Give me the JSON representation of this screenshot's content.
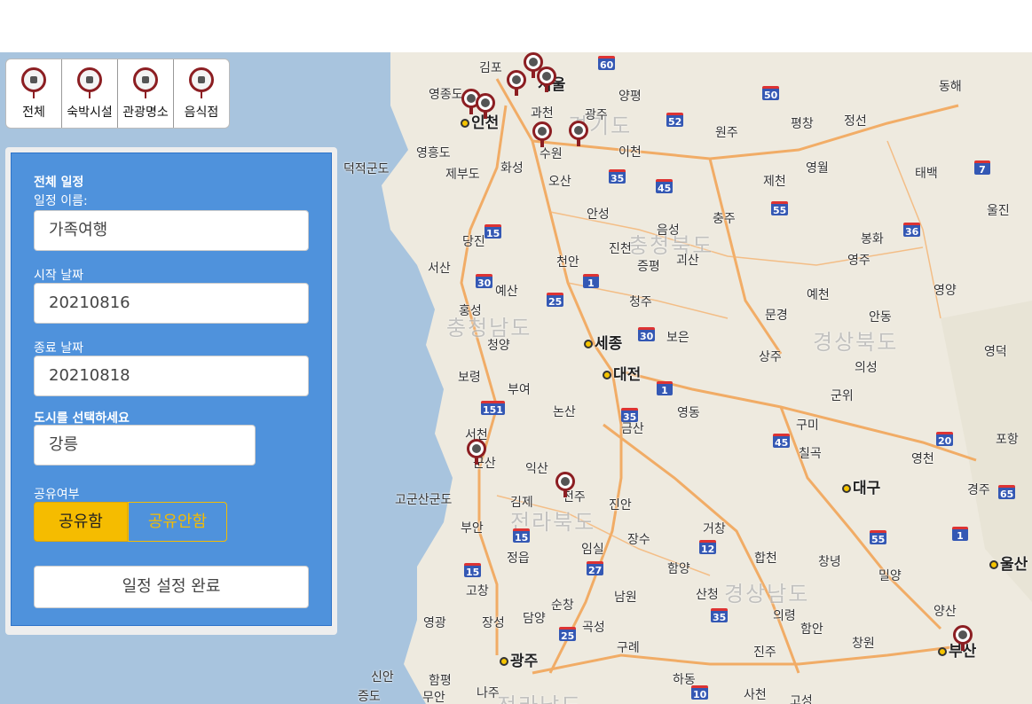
{
  "toolbar": {
    "items": [
      {
        "label": "전체",
        "icon": "airplane-pin-icon"
      },
      {
        "label": "숙박시설",
        "icon": "bed-pin-icon"
      },
      {
        "label": "관광명소",
        "icon": "camera-pin-icon"
      },
      {
        "label": "음식점",
        "icon": "restaurant-pin-icon"
      }
    ]
  },
  "panel": {
    "title": "전체 일정",
    "name_label": "일정 이름:",
    "name_value": "가족여행",
    "start_label": "시작 날짜",
    "start_value": "20210816",
    "end_label": "종료 날짜",
    "end_value": "20210818",
    "city_label": "도시를 선택하세요",
    "city_value": "강릉",
    "share_label": "공유여부",
    "share_on": "공유함",
    "share_off": "공유안함",
    "submit": "일정 설정 완료"
  },
  "map": {
    "cities": [
      "김포",
      "서울",
      "영종도",
      "인천",
      "과천",
      "광주",
      "양평",
      "수원",
      "이천",
      "원주",
      "평창",
      "정선",
      "동해",
      "영흥도",
      "덕적군도",
      "제부도",
      "화성",
      "오산",
      "영월",
      "태백",
      "울진",
      "안성",
      "음성",
      "충주",
      "제천",
      "당진",
      "진천",
      "증평",
      "괴산",
      "봉화",
      "영주",
      "서산",
      "천안",
      "예산",
      "청주",
      "예천",
      "영양",
      "홍성",
      "문경",
      "안동",
      "청양",
      "세종",
      "보은",
      "상주",
      "영덕",
      "보령",
      "대전",
      "의성",
      "부여",
      "영동",
      "군위",
      "논산",
      "금산",
      "구미",
      "포항",
      "서천",
      "군산",
      "칠곡",
      "영천",
      "고군산군도",
      "익산",
      "김제",
      "전주",
      "진안",
      "대구",
      "경주",
      "울산",
      "부안",
      "정읍",
      "임실",
      "장수",
      "거창",
      "합천",
      "창녕",
      "밀양",
      "고창",
      "함양",
      "산청",
      "남원",
      "양산",
      "영광",
      "장성",
      "담양",
      "순창",
      "의령",
      "함안",
      "창원",
      "부산",
      "곡성",
      "광주",
      "구례",
      "진주",
      "신안",
      "함평",
      "하동",
      "고성",
      "증도",
      "무안",
      "나주",
      "사천"
    ],
    "regions": [
      "경기도",
      "충청북도",
      "충청남도",
      "경상북도",
      "전라북도",
      "경상남도",
      "전라남도"
    ],
    "routes": [
      "60",
      "50",
      "52",
      "35",
      "45",
      "55",
      "15",
      "30",
      "1",
      "25",
      "36",
      "7",
      "151",
      "20",
      "65",
      "12",
      "27",
      "10"
    ],
    "colors": {
      "water": "#a8c4de",
      "land": "#eeeadf",
      "road": "#f2a65a",
      "pin": "#8c1e22",
      "panel": "#4f92dc",
      "accent": "#f5bc00"
    }
  }
}
